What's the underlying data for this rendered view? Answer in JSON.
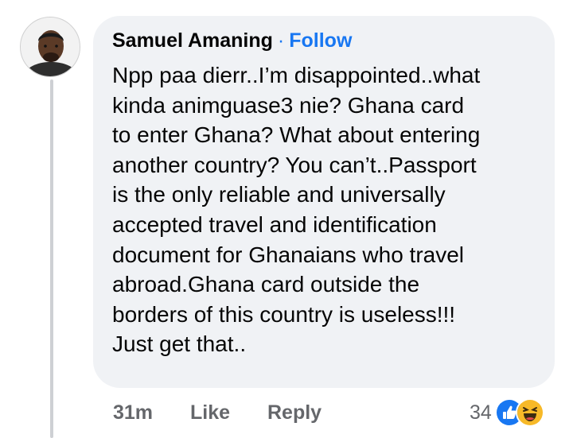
{
  "comment": {
    "author": "Samuel Amaning",
    "separator": "·",
    "follow_label": "Follow",
    "text": "Npp paa dierr..I’m disappointed..what\nkinda animguase3 nie? Ghana card\nto enter Ghana? What about entering\nanother country? You can’t..Passport\nis the only reliable and universally\naccepted travel and identification\ndocument for Ghanaians who travel\nabroad.Ghana card outside the\nborders of this country is useless!!!\nJust get that..",
    "time": "31m",
    "like_label": "Like",
    "reply_label": "Reply",
    "reaction_count": "34",
    "reactions": [
      "like-icon",
      "haha-icon"
    ]
  },
  "colors": {
    "bubble": "#f0f2f5",
    "link": "#1877f2",
    "meta": "#65676b",
    "text": "#050505"
  }
}
